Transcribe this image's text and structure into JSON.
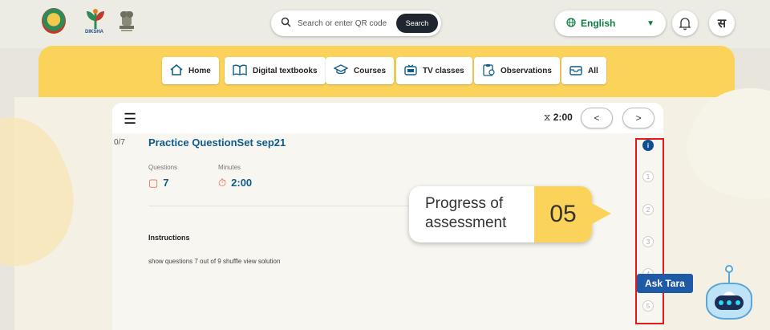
{
  "header": {
    "brand_text": "DIKSHA",
    "search": {
      "placeholder": "Search or enter QR code",
      "button_label": "Search"
    },
    "language": {
      "selected": "English"
    },
    "avatar_letter": "स"
  },
  "nav": {
    "items": [
      {
        "label": "Home",
        "icon": "home-icon"
      },
      {
        "label": "Digital textbooks",
        "icon": "book-icon"
      },
      {
        "label": "Courses",
        "icon": "graduation-cap-icon"
      },
      {
        "label": "TV classes",
        "icon": "tv-icon"
      },
      {
        "label": "Observations",
        "icon": "clipboard-icon"
      },
      {
        "label": "All",
        "icon": "inbox-icon"
      }
    ]
  },
  "player": {
    "timer": "2:00",
    "question_count": "0/7",
    "title": "Practice QuestionSet sep21",
    "questions_label": "Questions",
    "questions_value": "7",
    "minutes_label": "Minutes",
    "minutes_value": "2:00",
    "instructions_heading": "Instructions",
    "instructions_text": "show questions 7 out of 9 shuffle view solution",
    "steps": [
      "i",
      "1",
      "2",
      "3",
      "4",
      "5"
    ],
    "active_step_color": "#0d4f8f",
    "highlight_color": "#e31b1b"
  },
  "callout": {
    "text": "Progress of assessment",
    "number": "05",
    "accent_color": "#fcd35a"
  },
  "assistant": {
    "label": "Ask Tara"
  }
}
